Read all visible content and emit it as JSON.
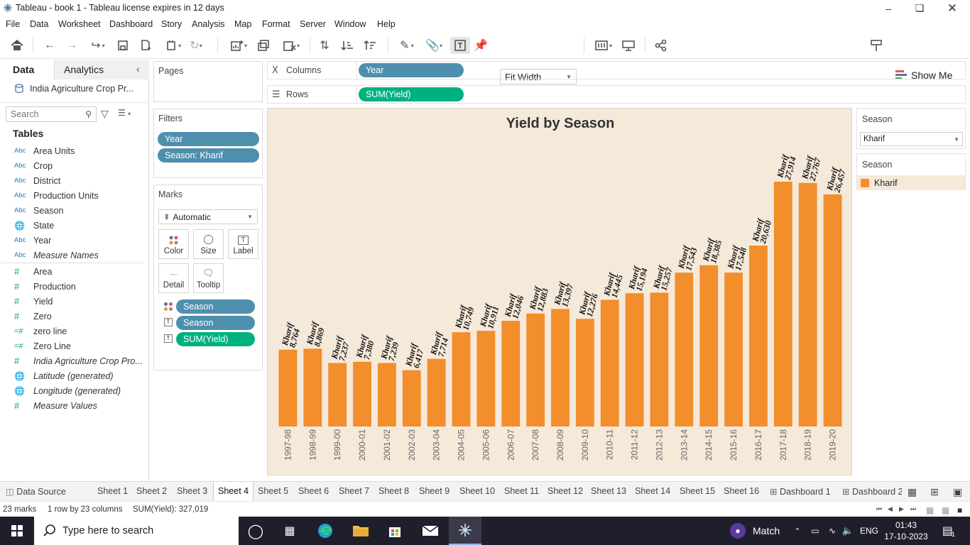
{
  "window": {
    "title": "Tableau - book 1 - Tableau license expires in 12 days"
  },
  "menu": [
    "File",
    "Data",
    "Worksheet",
    "Dashboard",
    "Story",
    "Analysis",
    "Map",
    "Format",
    "Server",
    "Window",
    "Help"
  ],
  "toolbar": {
    "fit_label": "Fit Width",
    "show_me_label": "Show Me"
  },
  "data_pane": {
    "tab_data": "Data",
    "tab_analytics": "Analytics",
    "datasource": "India Agriculture Crop Pr...",
    "search_placeholder": "Search",
    "tables_header": "Tables",
    "dimensions": [
      {
        "type": "Abc",
        "name": "Area Units"
      },
      {
        "type": "Abc",
        "name": "Crop"
      },
      {
        "type": "Abc",
        "name": "District"
      },
      {
        "type": "Abc",
        "name": "Production Units"
      },
      {
        "type": "Abc",
        "name": "Season"
      },
      {
        "type": "geo",
        "name": "State"
      },
      {
        "type": "Abc",
        "name": "Year"
      },
      {
        "type": "Abc",
        "name": "Measure Names"
      }
    ],
    "measures": [
      {
        "type": "#",
        "name": "Area"
      },
      {
        "type": "#",
        "name": "Production"
      },
      {
        "type": "#",
        "name": "Yield"
      },
      {
        "type": "#",
        "name": "Zero"
      },
      {
        "type": "=#",
        "name": "zero line"
      },
      {
        "type": "=#",
        "name": "Zero Line"
      },
      {
        "type": "#",
        "name": "India Agriculture Crop Pro..."
      },
      {
        "type": "geo",
        "name": "Latitude (generated)"
      },
      {
        "type": "geo",
        "name": "Longitude (generated)"
      },
      {
        "type": "#",
        "name": "Measure Values"
      }
    ]
  },
  "pages": {
    "title": "Pages"
  },
  "filters": {
    "title": "Filters",
    "pills": [
      "Year",
      "Season: Kharif"
    ]
  },
  "marks": {
    "title": "Marks",
    "type": "Automatic",
    "buttons": [
      "Color",
      "Size",
      "Label",
      "Detail",
      "Tooltip"
    ],
    "pills": [
      {
        "icon": "color",
        "label": "Season"
      },
      {
        "icon": "label",
        "label": "Season"
      },
      {
        "icon": "label",
        "label": "SUM(Yield)"
      }
    ]
  },
  "shelves": {
    "columns_label": "Columns",
    "columns_pill": "Year",
    "rows_label": "Rows",
    "rows_pill": "SUM(Yield)"
  },
  "right_panel": {
    "filter_title": "Season",
    "filter_value": "Kharif",
    "legend_title": "Season",
    "legend_item": "Kharif",
    "legend_color": "#f28e2b"
  },
  "chart_data": {
    "type": "bar",
    "title": "Yield by Season",
    "bar_color": "#f28e2b",
    "categories": [
      "1997-98",
      "1998-99",
      "1999-00",
      "2000-01",
      "2001-02",
      "2002-03",
      "2003-04",
      "2004-05",
      "2005-06",
      "2006-07",
      "2007-08",
      "2008-09",
      "2009-10",
      "2010-11",
      "2011-12",
      "2012-13",
      "2013-14",
      "2014-15",
      "2015-16",
      "2016-17",
      "2017-18",
      "2018-19",
      "2019-20"
    ],
    "series": [
      {
        "name": "Kharif",
        "values": [
          8764,
          8869,
          7237,
          7380,
          7239,
          6417,
          7714,
          10749,
          10911,
          12046,
          12883,
          13397,
          12276,
          14445,
          15194,
          15257,
          17543,
          18385,
          17548,
          20630,
          27914,
          27767,
          26457
        ],
        "labels": [
          "8,764",
          "8,869",
          "7,237",
          "7,380",
          "7,239",
          "6,417",
          "7,714",
          "10,749",
          "10,911",
          "12,046",
          "12,883",
          "13,397",
          "12,276",
          "14,445",
          "15,194",
          "15,257",
          "17,543",
          "18,385",
          "17,548",
          "20,630",
          "27,914",
          "27,767",
          "26,457"
        ]
      }
    ],
    "label_prefix": "Kharif",
    "ylim": [
      0,
      27914
    ]
  },
  "sheet_tabs": [
    "Data Source",
    "Sheet 1",
    "Sheet 2",
    "Sheet 3",
    "Sheet 4",
    "Sheet 5",
    "Sheet 6",
    "Sheet 7",
    "Sheet 8",
    "Sheet 9",
    "Sheet 10",
    "Sheet 11",
    "Sheet 12",
    "Sheet 13",
    "Sheet 14",
    "Sheet 15",
    "Sheet 16",
    "Dashboard 1",
    "Dashboard 2"
  ],
  "active_sheet": "Sheet 4",
  "status": {
    "marks": "23 marks",
    "layout": "1 row by 23 columns",
    "sum": "SUM(Yield): 327,019"
  },
  "taskbar": {
    "search_placeholder": "Type here to search",
    "weather": "Match",
    "lang": "ENG",
    "time": "01:43",
    "date": "17-10-2023",
    "notif_count": "1"
  }
}
